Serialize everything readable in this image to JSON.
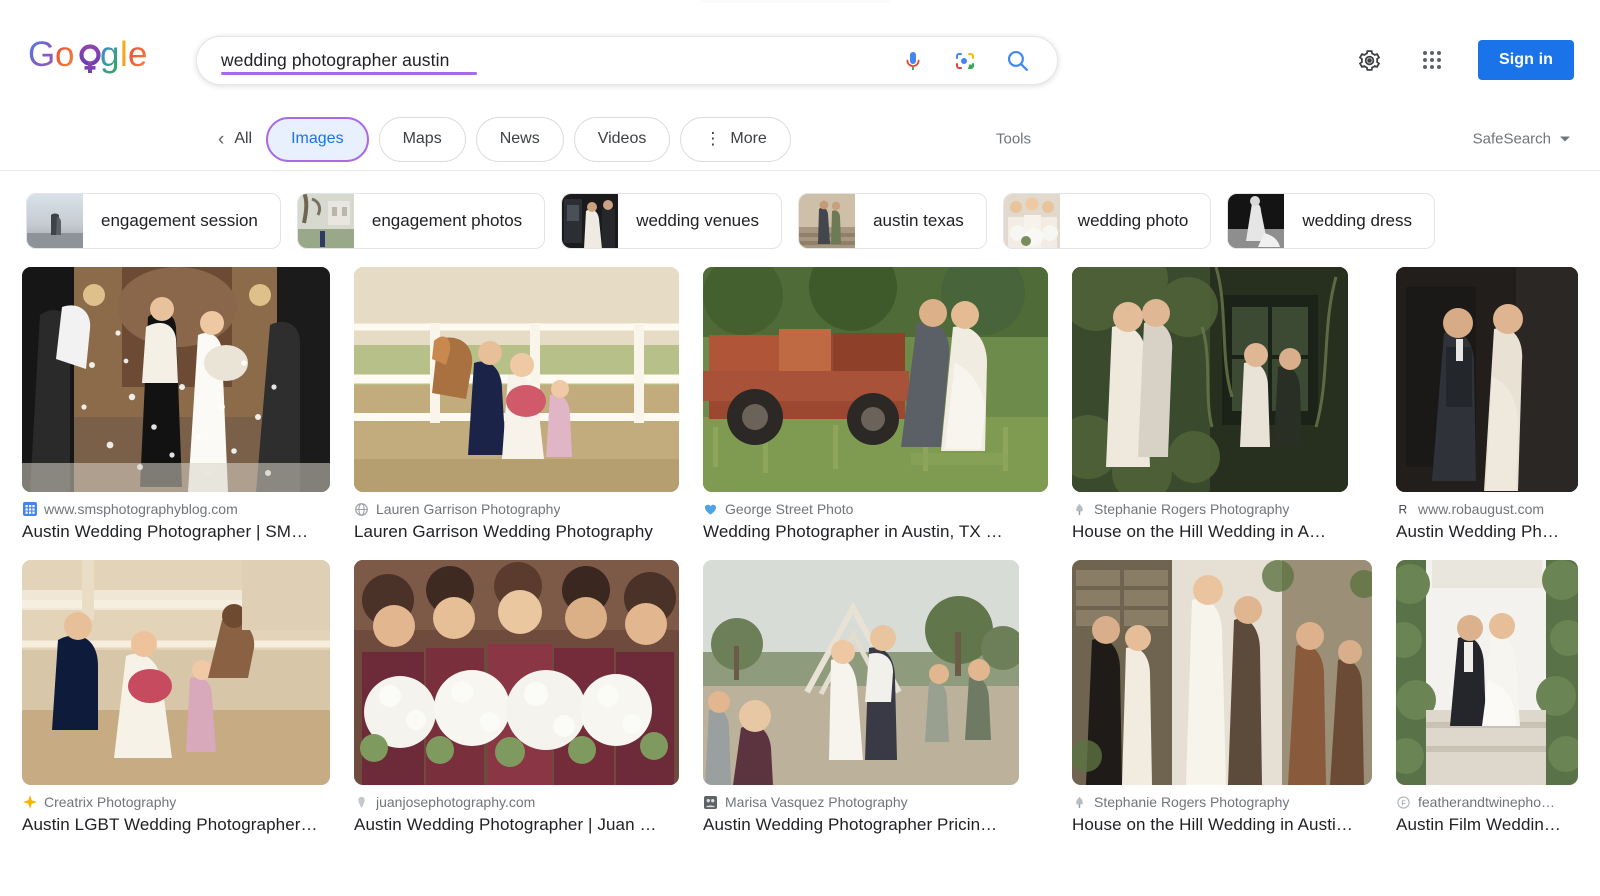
{
  "brand": {
    "logo_text": "Google",
    "colors": {
      "blue": "#4285F4",
      "red": "#EA4335",
      "yellow": "#FBBC05",
      "green": "#34A853",
      "purple": "#a96ae8",
      "signin_blue": "#1a73e8"
    }
  },
  "search": {
    "query": "wedding photographer austin",
    "placeholder": "Search",
    "mic_icon": "microphone-icon",
    "lens_icon": "google-lens-icon",
    "submit_icon": "search-icon"
  },
  "header": {
    "settings_icon": "gear-icon",
    "apps_icon": "google-apps-grid-icon",
    "signin_label": "Sign in"
  },
  "nav": {
    "back_icon": "chevron-left-icon",
    "all_label": "All",
    "tabs": [
      {
        "label": "Images",
        "active": true
      },
      {
        "label": "Maps",
        "active": false
      },
      {
        "label": "News",
        "active": false
      },
      {
        "label": "Videos",
        "active": false
      },
      {
        "label": "More",
        "active": false,
        "icon": "more-vertical-icon"
      }
    ],
    "tools_label": "Tools",
    "safesearch_label": "SafeSearch",
    "safesearch_caret": "chevron-down-icon"
  },
  "chips": [
    {
      "label": "engagement session",
      "thumb": "couple-on-road-at-dusk"
    },
    {
      "label": "engagement photos",
      "thumb": "couple-walking-by-tree"
    },
    {
      "label": "wedding venues",
      "thumb": "bride-and-groom-by-car"
    },
    {
      "label": "austin texas",
      "thumb": "couple-on-stone-steps"
    },
    {
      "label": "wedding photo",
      "thumb": "bridesmaids-with-bouquets"
    },
    {
      "label": "wedding dress",
      "thumb": "bride-black-and-white"
    }
  ],
  "results": {
    "row1": [
      {
        "source": "www.smsphotographyblog.com",
        "title": "Austin Wedding Photographer | SM…",
        "favicon": "blue-grid-favicon",
        "favicon_color": "#4285F4",
        "alt": "bride and groom exiting under confetti toss"
      },
      {
        "source": "Lauren Garrison Photography",
        "title": "Lauren Garrison Wedding Photography",
        "favicon": "globe-favicon",
        "favicon_color": "#9aa0a6",
        "alt": "couple with horse at white fence ranch"
      },
      {
        "source": "George Street Photo",
        "title": "Wedding Photographer in Austin, TX …",
        "favicon": "blue-heart-favicon",
        "favicon_color": "#4fa3e3",
        "alt": "couple kissing beside vintage red truck"
      },
      {
        "source": "Stephanie Rogers Photography",
        "title": "House on the Hill Wedding in A…",
        "favicon": "tree-favicon",
        "favicon_color": "#9aa0a6",
        "alt": "collage of couple by greenery and window"
      },
      {
        "source": "www.robaugust.com",
        "title": "Austin Wedding Ph…",
        "favicon": "letter-r-favicon",
        "favicon_color": "#3c4043",
        "alt": "couple holding hands in dark interior"
      }
    ],
    "row2": [
      {
        "source": "Creatrix Photography",
        "title": "Austin LGBT Wedding Photographer…",
        "favicon": "yellow-sparkle-favicon",
        "favicon_color": "#f5b400",
        "alt": "couple laughing in floral arch doorway"
      },
      {
        "source": "juanjosephotography.com",
        "title": "Austin Wedding Photographer | Juan …",
        "favicon": "grey-pin-favicon",
        "favicon_color": "#bdc1c6",
        "alt": "bridesmaids holding white bouquets"
      },
      {
        "source": "Marisa Vasquez Photography",
        "title": "Austin Wedding Photographer Pricin…",
        "favicon": "photo-favicon",
        "favicon_color": "#5f6368",
        "alt": "outdoor hill country ceremony with guests"
      },
      {
        "source": "Stephanie Rogers Photography",
        "title": "House on the Hill Wedding in Austi…",
        "favicon": "tree-favicon",
        "favicon_color": "#9aa0a6",
        "alt": "collage of wedding party by stone wall"
      },
      {
        "source": "featherandtwinepho…",
        "title": "Austin Film Weddin…",
        "favicon": "circle-f-favicon",
        "favicon_color": "#9aa0a6",
        "alt": "couple under greenery arch at altar"
      }
    ]
  }
}
